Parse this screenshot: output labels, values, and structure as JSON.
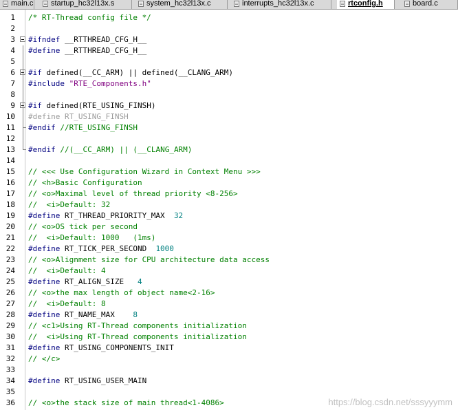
{
  "tabs": [
    {
      "label": "main.c",
      "active": false
    },
    {
      "label": "startup_hc32l13x.s",
      "active": false
    },
    {
      "label": "system_hc32l13x.c",
      "active": false
    },
    {
      "label": "interrupts_hc32l13x.c",
      "active": false
    },
    {
      "label": "rtconfig.h",
      "active": true
    },
    {
      "label": "board.c",
      "active": false
    }
  ],
  "editor": {
    "lines": [
      {
        "n": "1",
        "text": "/* RT-Thread config file */"
      },
      {
        "n": "2",
        "text": ""
      },
      {
        "n": "3",
        "text": "#ifndef __RTTHREAD_CFG_H__"
      },
      {
        "n": "4",
        "text": "#define __RTTHREAD_CFG_H__"
      },
      {
        "n": "5",
        "text": ""
      },
      {
        "n": "6",
        "text": "#if defined(__CC_ARM) || defined(__CLANG_ARM)"
      },
      {
        "n": "7",
        "text": "#include \"RTE_Components.h\""
      },
      {
        "n": "8",
        "text": ""
      },
      {
        "n": "9",
        "text": "#if defined(RTE_USING_FINSH)"
      },
      {
        "n": "10",
        "text": "#define RT_USING_FINSH"
      },
      {
        "n": "11",
        "text": "#endif //RTE_USING_FINSH"
      },
      {
        "n": "12",
        "text": ""
      },
      {
        "n": "13",
        "text": "#endif //(__CC_ARM) || (__CLANG_ARM)"
      },
      {
        "n": "14",
        "text": ""
      },
      {
        "n": "15",
        "text": "// <<< Use Configuration Wizard in Context Menu >>>"
      },
      {
        "n": "16",
        "text": "// <h>Basic Configuration"
      },
      {
        "n": "17",
        "text": "// <o>Maximal level of thread priority <8-256>"
      },
      {
        "n": "18",
        "text": "//  <i>Default: 32"
      },
      {
        "n": "19",
        "text": "#define RT_THREAD_PRIORITY_MAX  32"
      },
      {
        "n": "20",
        "text": "// <o>OS tick per second"
      },
      {
        "n": "21",
        "text": "//  <i>Default: 1000   (1ms)"
      },
      {
        "n": "22",
        "text": "#define RT_TICK_PER_SECOND  1000"
      },
      {
        "n": "23",
        "text": "// <o>Alignment size for CPU architecture data access"
      },
      {
        "n": "24",
        "text": "//  <i>Default: 4"
      },
      {
        "n": "25",
        "text": "#define RT_ALIGN_SIZE   4"
      },
      {
        "n": "26",
        "text": "// <o>the max length of object name<2-16>"
      },
      {
        "n": "27",
        "text": "//  <i>Default: 8"
      },
      {
        "n": "28",
        "text": "#define RT_NAME_MAX    8"
      },
      {
        "n": "29",
        "text": "// <c1>Using RT-Thread components initialization"
      },
      {
        "n": "30",
        "text": "//  <i>Using RT-Thread components initialization"
      },
      {
        "n": "31",
        "text": "#define RT_USING_COMPONENTS_INIT"
      },
      {
        "n": "32",
        "text": "// </c>"
      },
      {
        "n": "33",
        "text": ""
      },
      {
        "n": "34",
        "text": "#define RT_USING_USER_MAIN"
      },
      {
        "n": "35",
        "text": ""
      },
      {
        "n": "36",
        "text": "// <o>the stack size of main thread<1-4086>"
      }
    ]
  },
  "watermark": "https://blog.csdn.net/sssyyymm",
  "colors": {
    "comment": "#008000",
    "preprocessor": "#000080",
    "string": "#800080",
    "number": "#008080",
    "inactive": "#9a9a9a"
  }
}
